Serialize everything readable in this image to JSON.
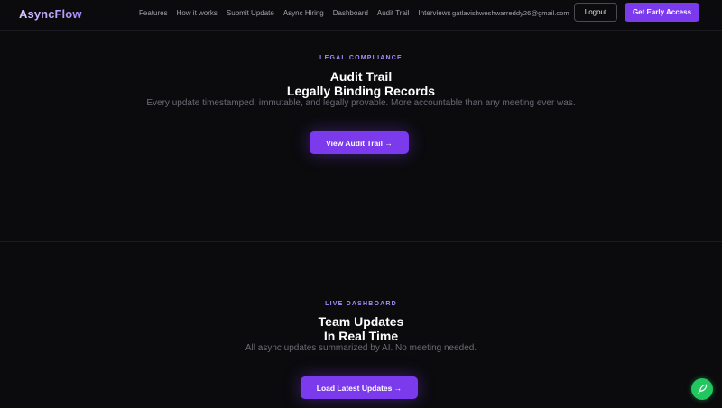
{
  "brand": {
    "name": "AsyncFlow"
  },
  "nav": {
    "links": [
      "Features",
      "How it works",
      "Submit Update",
      "Async Hiring",
      "Dashboard",
      "Audit Trail",
      "Interviews"
    ],
    "user_email": "gatlavishweshwarreddy26@gmail.com",
    "logout_label": "Logout",
    "cta_label": "Get Early Access"
  },
  "audit": {
    "eyebrow": "LEGAL COMPLIANCE",
    "title_line1": "Audit Trail",
    "title_line2": "Legally Binding Records",
    "subtitle": "Every update timestamped, immutable, and legally provable. More accountable than any meeting ever was.",
    "button_label": "View Audit Trail →"
  },
  "dashboard": {
    "eyebrow": "LIVE DASHBOARD",
    "title_line1": "Team Updates",
    "title_line2": "In Real Time",
    "subtitle": "All async updates summarized by AI. No meeting needed.",
    "button_label": "Load Latest Updates →"
  },
  "colors": {
    "background": "#0b0b0d",
    "accent": "#7c3aed",
    "accent_text": "#a78bfa",
    "fab": "#22c55e"
  },
  "fab": {
    "icon": "feather-icon"
  }
}
